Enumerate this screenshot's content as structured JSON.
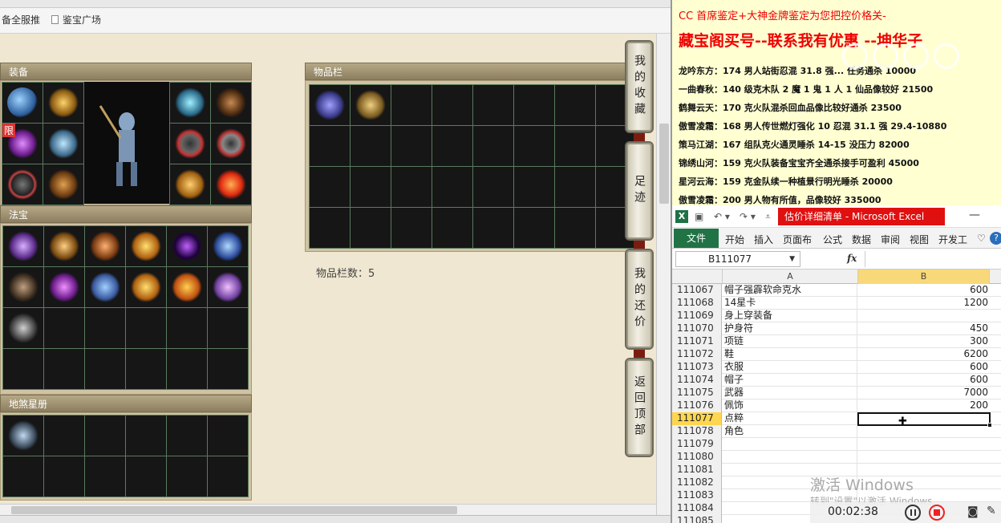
{
  "browser": {
    "bookmarks": [
      {
        "label": "备全服推"
      },
      {
        "label": "鉴宝广场"
      }
    ]
  },
  "game": {
    "panels": {
      "equipment_title": "装备",
      "fabao_title": "法宝",
      "stars_title": "地煞星册",
      "items_title": "物品栏",
      "item_count_text": "物品栏数：5",
      "limit_badge": "限"
    },
    "side_buttons": [
      {
        "label": "我的收藏"
      },
      {
        "label": "足迹"
      },
      {
        "label": "我的还价"
      },
      {
        "label": "返回顶部"
      }
    ],
    "icons": {
      "equipment_left": [
        "helmet-icon",
        "weapon-icon",
        "blade-icon",
        "orb-icon",
        "ring-icon",
        "armor-icon"
      ],
      "equipment_right": [
        "mask-icon",
        "necklace-icon",
        "ring-icon",
        "ring-icon",
        "belt-icon",
        "sun-icon"
      ],
      "fabao": [
        "claw-icon",
        "scroll-icon",
        "pipa-icon",
        "lantern-icon",
        "vortex-icon",
        "blade-icon",
        "bag-icon",
        "whip-icon",
        "fan-icon",
        "lantern-icon",
        "flame-icon",
        "bug-icon",
        "hook-icon"
      ],
      "items": [
        "cloth-bag-icon",
        "skull-treasure-icon"
      ],
      "stars": [
        "warrior-portrait-icon"
      ]
    }
  },
  "notes": {
    "line1": "CC 首席鉴定+大神金牌鉴定为您把控价格关-",
    "line2": "藏宝阁买号--联系我有优惠 --坤华子",
    "entries": [
      "龙吟东方：174 男人站街忍混 31.8 强... 任务通杀 10000",
      "一曲春秋：140 级克木队 2 魔 1 鬼 1 人 1 仙品像较好 21500",
      "鹤舞云天：170 克火队混杀回血品像比较好通杀 23500",
      "傲雪凌霜：168 男人传世燃灯强化 10 忍混 31.1 强 29.4-10880",
      "策马江湖：167 组队克火通灵睡杀 14-15 没压力 82000",
      "锦绣山河：159 克火队装备宝宝齐全通杀接手可盈利 45000",
      "星河云海：159 克金队续一种植景行明光睡杀 20000",
      "傲雪凌霜：200 男人物有所值，品像较好 335000"
    ]
  },
  "excel": {
    "doc_title": "估价详细清单 - Microsoft Excel",
    "ribbon_tabs": [
      "文件",
      "开始",
      "插入",
      "页面布",
      "公式",
      "数据",
      "审阅",
      "视图",
      "开发工"
    ],
    "name_box": "B111077",
    "fx_label": "fx",
    "col_a": "A",
    "col_b": "B",
    "rows": [
      {
        "n": "111067",
        "a": "帽子强霹软命克水",
        "b": "600"
      },
      {
        "n": "111068",
        "a": "14星卡",
        "b": "1200"
      },
      {
        "n": "111069",
        "a": "身上穿装备",
        "b": ""
      },
      {
        "n": "111070",
        "a": "护身符",
        "b": "450"
      },
      {
        "n": "111071",
        "a": "项链",
        "b": "300"
      },
      {
        "n": "111072",
        "a": "鞋",
        "b": "6200"
      },
      {
        "n": "111073",
        "a": "衣服",
        "b": "600"
      },
      {
        "n": "111074",
        "a": "帽子",
        "b": "600"
      },
      {
        "n": "111075",
        "a": "武器",
        "b": "7000"
      },
      {
        "n": "111076",
        "a": "佩饰",
        "b": "200"
      },
      {
        "n": "111077",
        "a": "点粹",
        "b": ""
      },
      {
        "n": "111078",
        "a": "角色",
        "b": ""
      },
      {
        "n": "111079",
        "a": "",
        "b": ""
      },
      {
        "n": "111080",
        "a": "",
        "b": ""
      },
      {
        "n": "111081",
        "a": "",
        "b": ""
      },
      {
        "n": "111082",
        "a": "",
        "b": ""
      },
      {
        "n": "111083",
        "a": "",
        "b": ""
      },
      {
        "n": "111084",
        "a": "",
        "b": ""
      },
      {
        "n": "111085",
        "a": "",
        "b": ""
      }
    ],
    "selected_row": "111077",
    "activate_line1": "激活 Windows",
    "activate_line2": "转到\"设置\"以激活 Windows。"
  },
  "recorder": {
    "time": "00:02:38"
  },
  "colors": {
    "red_text": "#e00000",
    "excel_green": "#217346",
    "title_red": "#e01010",
    "grid_line": "#5a7a5e"
  }
}
